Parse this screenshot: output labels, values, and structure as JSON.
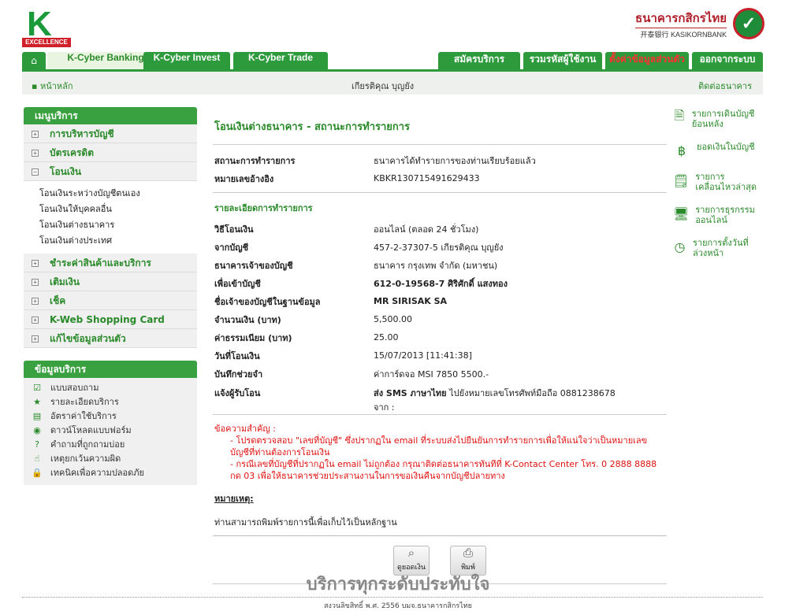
{
  "header": {
    "logo_letter": "K",
    "logo_label": "EXCELLENCE",
    "bank_name_th": "ธนาคารกสิกรไทย",
    "bank_name_en": "开泰银行 KASIKORNBANK"
  },
  "tabs": {
    "left": [
      "K-Cyber Banking",
      "K-Cyber Invest",
      "K-Cyber Trade"
    ],
    "right": [
      "สมัครบริการ",
      "รวมรหัสผู้ใช้งาน",
      "ตั้งค่าข้อมูลส่วนตัว",
      "ออกจากระบบ"
    ]
  },
  "subbar": {
    "home": "หน้าหลัก",
    "user": "เกียรติคุณ บุญยัง",
    "contact": "ติดต่อธนาคาร"
  },
  "menu": {
    "title": "เมนูบริการ",
    "items": [
      "การบริหารบัญชี",
      "บัตรเครดิต",
      "โอนเงิน"
    ],
    "transfer_sub": [
      "โอนเงินระหว่างบัญชีตนเอง",
      "โอนเงินให้บุคคลอื่น",
      "โอนเงินต่างธนาคาร",
      "โอนเงินต่างประเทศ"
    ],
    "items2": [
      "ชำระค่าสินค้าและบริการ",
      "เติมเงิน",
      "เช็ค",
      "K-Web Shopping Card",
      "แก้ไขข้อมูลส่วนตัว"
    ]
  },
  "info": {
    "title": "ข้อมูลบริการ",
    "items": [
      "แบบสอบถาม",
      "รายละเอียดบริการ",
      "อัตราค่าใช้บริการ",
      "ดาวน์โหลดแบบฟอร์ม",
      "คำถามที่ถูกถามบ่อย",
      "เหตุยกเว้นความผิด",
      "เทคนิคเพื่อความปลอดภัย"
    ]
  },
  "main": {
    "title": "โอนเงินต่างธนาคาร - สถานะการทำรายการ",
    "status_label": "สถานะการทำรายการ",
    "status_value": "ธนาคารได้ทำรายการของท่านเรียบร้อยแล้ว",
    "ref_label": "หมายเลขอ้างอิง",
    "ref_value": "KBKR130715491629433",
    "detail_title": "รายละเอียดการทำรายการ",
    "details": [
      {
        "label": "วิธีโอนเงิน",
        "value": "ออนไลน์ (ตลอด 24 ชั่วโมง)"
      },
      {
        "label": "จากบัญชี",
        "value": "457-2-37307-5 เกียรติคุณ บุญยัง"
      },
      {
        "label": "ธนาคารเจ้าของบัญชี",
        "value": "ธนาคาร กรุงเทพ จำกัด (มหาชน)"
      },
      {
        "label": "เพื่อเข้าบัญชี",
        "value": "612-0-19568-7 ศิริศักดิ์ แสงทอง"
      },
      {
        "label": "ชื่อเจ้าของบัญชีในฐานข้อมูล",
        "value": "MR SIRISAK SA"
      },
      {
        "label": "จำนวนเงิน (บาท)",
        "value": "5,500.00"
      },
      {
        "label": "ค่าธรรมเนียม (บาท)",
        "value": "25.00"
      },
      {
        "label": "วันที่โอนเงิน",
        "value": "15/07/2013 [11:41:38]"
      },
      {
        "label": "บันทึกช่วยจำ",
        "value": "ค่าการ์ดจอ MSI 7850 5500.-"
      }
    ],
    "notify_label": "แจ้งผู้รับโอน",
    "notify_bold": "ส่ง SMS ภาษาไทย",
    "notify_value": " ไปยังหมายเลขโทรศัพท์มือถือ 0881238678",
    "notify_line2": "จาก :",
    "notice_head": "ข้อความสำคัญ :",
    "notice_1": "- โปรดตรวจสอบ \"เลขที่บัญชี\" ซึ่งปรากฏใน email ที่ระบบส่งไปยืนยันการทำรายการเพื่อให้แน่ใจว่าเป็นหมายเลขบัญชีที่ท่านต้องการโอนเงิน",
    "notice_2": "- กรณีเลขที่บัญชีที่ปรากฏใน email ไม่ถูกต้อง กรุณาติดต่อธนาคารทันทีที่ K-Contact Center โทร. 0 2888 8888 กด 03 เพื่อให้ธนาคารช่วยประสานงานในการขอเงินคืนจากบัญชีปลายทาง",
    "remark_head": "หมายเหตุ:",
    "remark": "ท่านสามารถพิมพ์รายการนี้เพื่อเก็บไว้เป็นหลักฐาน",
    "btn_balance": "ดูยอดเงิน",
    "btn_print": "พิมพ์"
  },
  "right": [
    "รายการเดินบัญชีย้อนหลัง",
    "ยอดเงินในบัญชี",
    "รายการเคลื่อนไหวล่าสุด",
    "รายการธุรกรรมออนไลน์",
    "รายการตั้งวันที่ล่วงหน้า"
  ],
  "footer": {
    "slogan": "บริการทุกระดับประทับใจ",
    "copyright": "สงวนลิขสิทธิ์ พ.ศ. 2556 บมจ.ธนาคารกสิกรไทย"
  }
}
